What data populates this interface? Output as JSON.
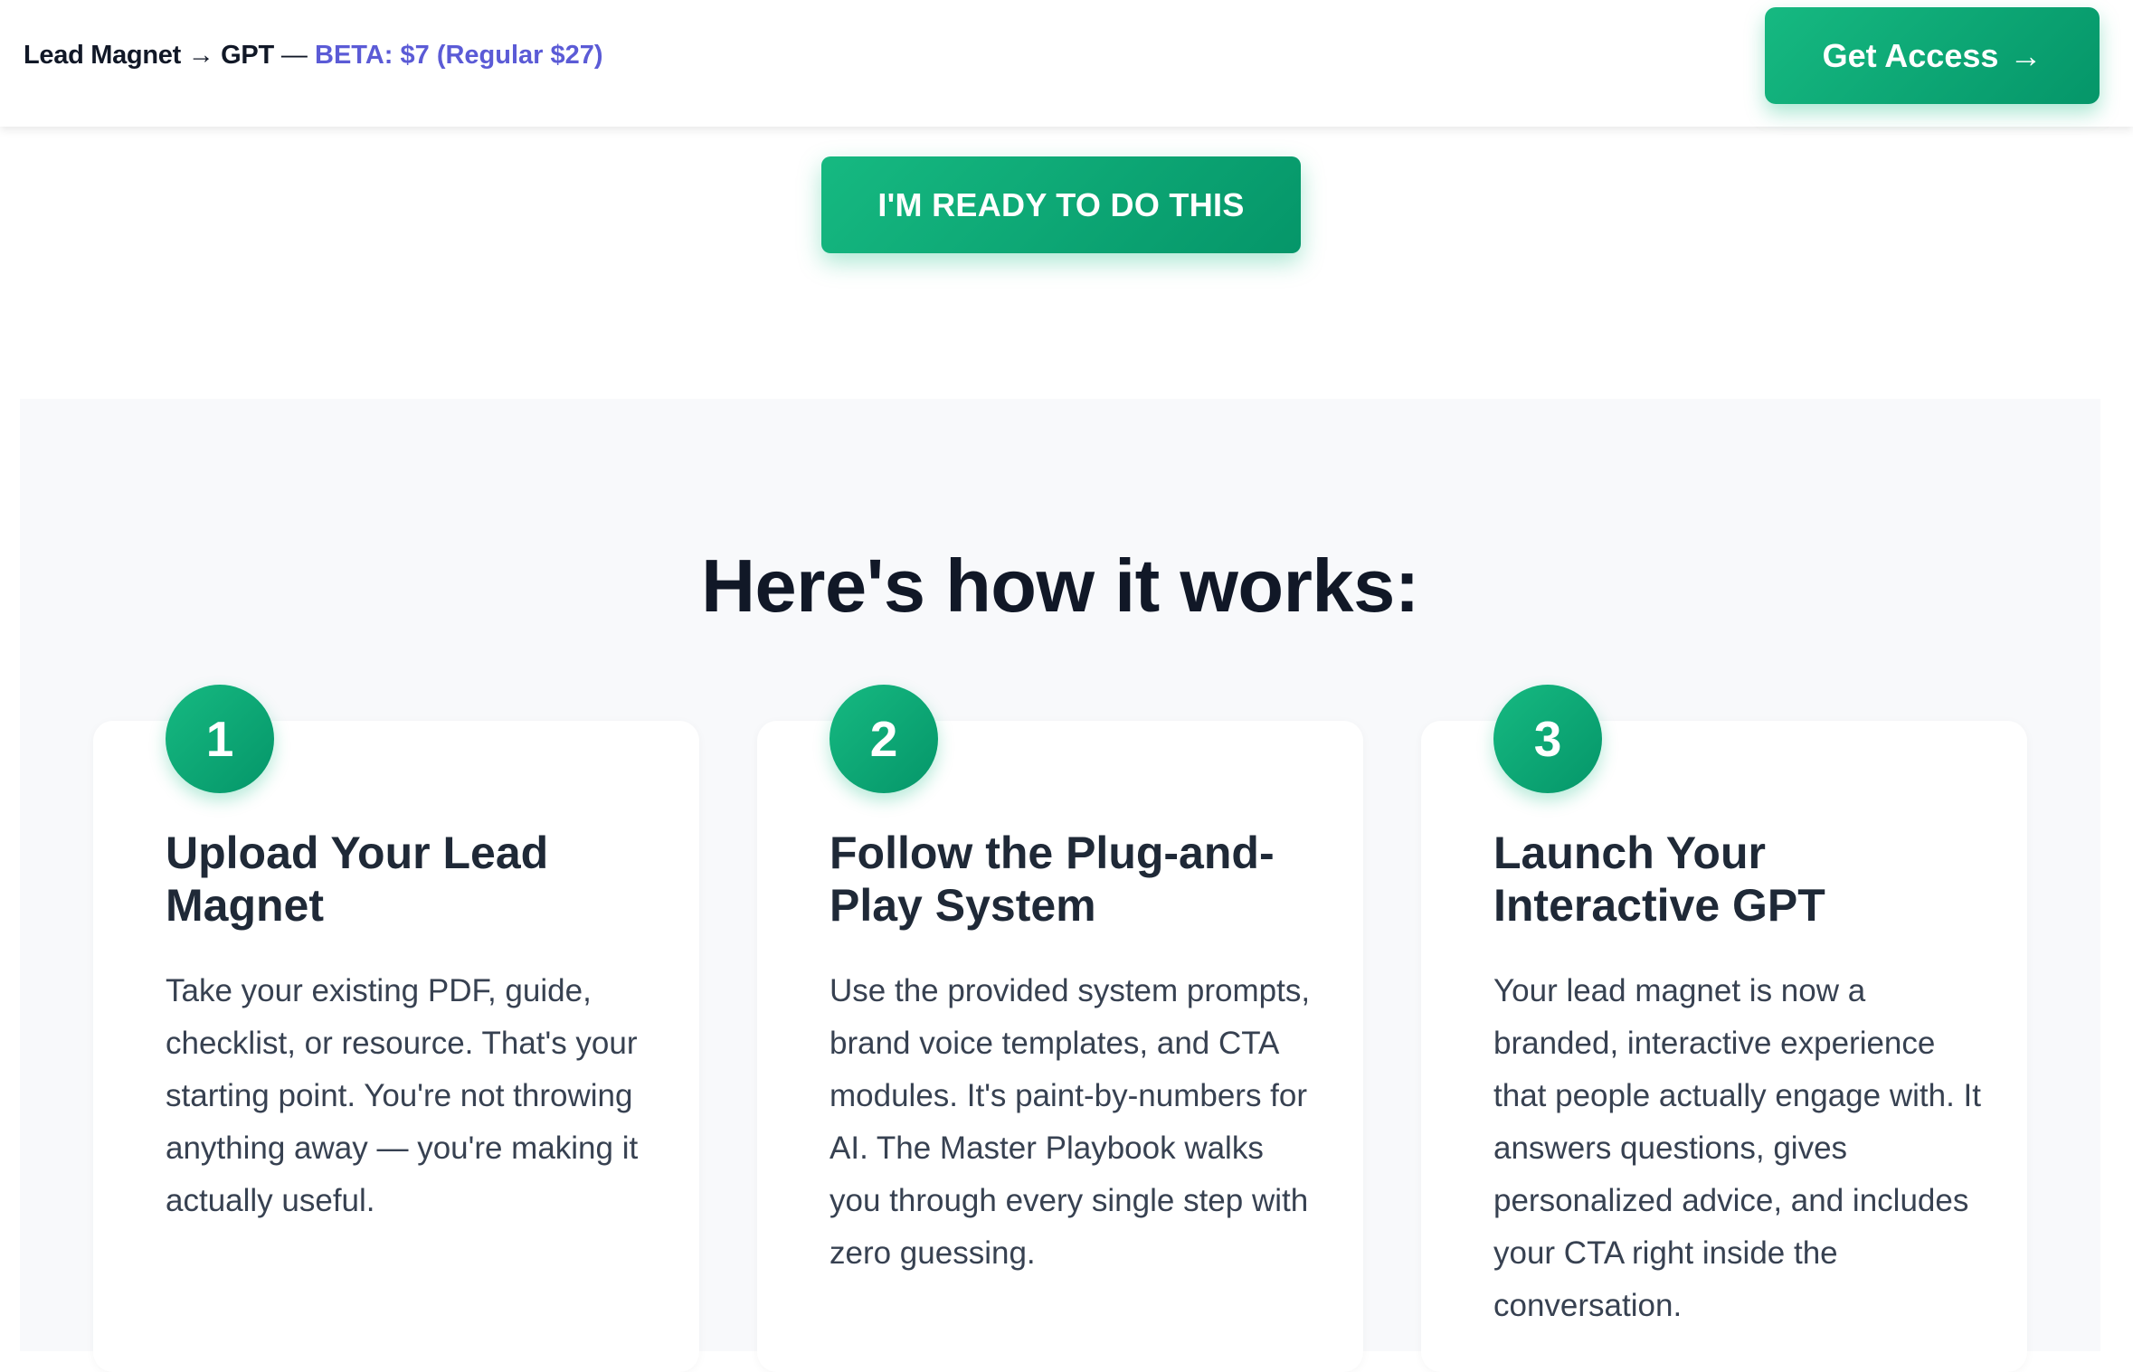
{
  "header": {
    "brand": "Lead Magnet → GPT",
    "separator": " — ",
    "beta_text": "BETA: $7 (Regular $27)",
    "cta_label": "Get Access",
    "cta_arrow": "→"
  },
  "hero": {
    "ready_label": "I'M READY TO DO THIS"
  },
  "how_it_works": {
    "title": "Here's how it works:",
    "steps": [
      {
        "number": "1",
        "title": "Upload Your Lead Magnet",
        "text": "Take your existing PDF, guide, checklist, or resource. That's your starting point. You're not throwing anything away — you're making it actually useful."
      },
      {
        "number": "2",
        "title": "Follow the Plug-and-Play System",
        "text": "Use the provided system prompts, brand voice templates, and CTA modules. It's paint-by-numbers for AI. The Master Playbook walks you through every single step with zero guessing."
      },
      {
        "number": "3",
        "title": "Launch Your Interactive GPT",
        "text": "Your lead magnet is now a branded, interactive experience that people actually engage with. It answers questions, gives personalized advice, and includes your CTA right inside the conversation."
      }
    ]
  },
  "colors": {
    "accent_green": "#10b981",
    "accent_green_dark": "#059669",
    "beta_purple": "#5b5bd6",
    "section_bg": "#f8f9fb"
  }
}
